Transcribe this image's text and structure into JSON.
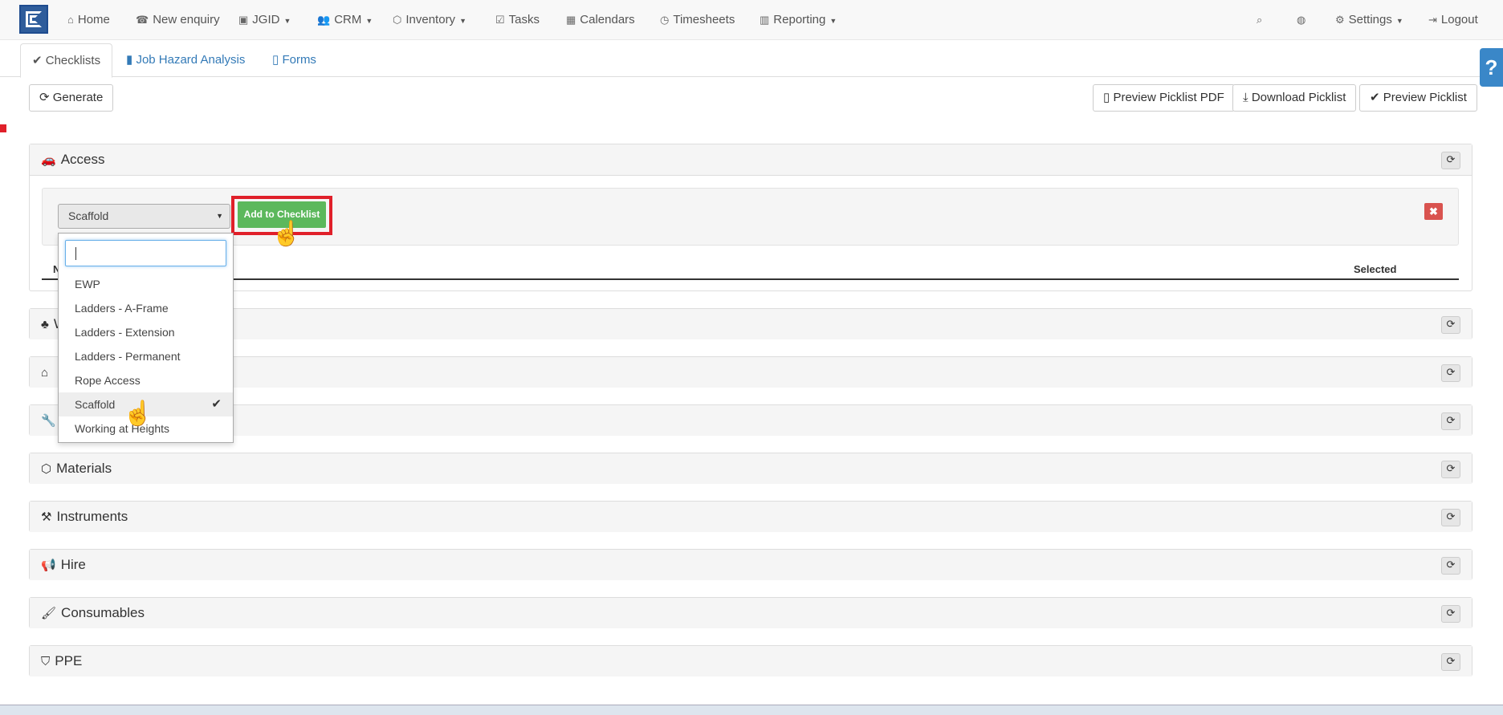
{
  "nav": {
    "home": "Home",
    "new_enquiry": "New enquiry",
    "jgid": "JGID",
    "crm": "CRM",
    "inventory": "Inventory",
    "tasks": "Tasks",
    "calendars": "Calendars",
    "timesheets": "Timesheets",
    "reporting": "Reporting",
    "settings": "Settings",
    "logout": "Logout"
  },
  "tabs": {
    "checklists": "Checklists",
    "jha": "Job Hazard Analysis",
    "forms": "Forms"
  },
  "toolbar": {
    "generate": "Generate",
    "preview_pdf": "Preview Picklist PDF",
    "download": "Download Picklist",
    "preview": "Preview Picklist"
  },
  "access_panel": {
    "title": "Access",
    "select_value": "Scaffold",
    "add_button": "Add to Checklist",
    "col_selected": "Selected",
    "col_name_fragment": "N"
  },
  "dropdown": {
    "options": [
      "EWP",
      "Ladders - A-Frame",
      "Ladders - Extension",
      "Ladders - Permanent",
      "Rope Access",
      "Scaffold",
      "Working at Heights"
    ],
    "selected": "Scaffold"
  },
  "panels": {
    "p2_fragment": "W",
    "materials": "Materials",
    "instruments": "Instruments",
    "hire": "Hire",
    "consumables": "Consumables",
    "ppe": "PPE"
  },
  "help": "?",
  "icons": {
    "home": "home-icon",
    "phone": "phone-icon",
    "search": "search-icon",
    "globe": "globe-icon",
    "gear": "gear-icon",
    "logout": "logout-icon"
  }
}
